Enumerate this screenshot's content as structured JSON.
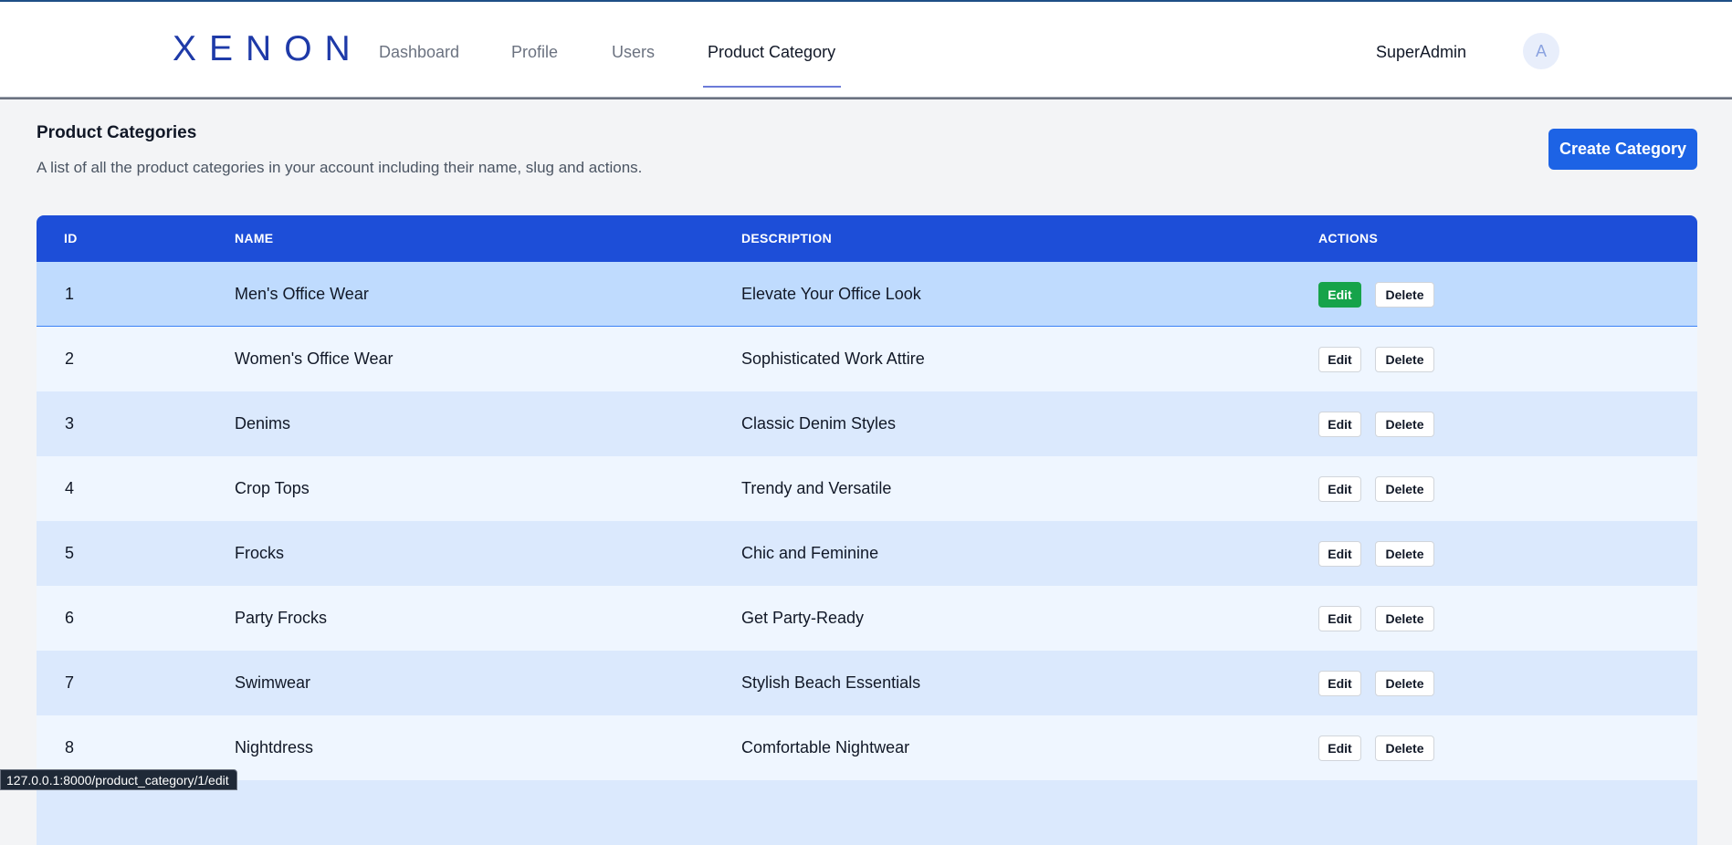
{
  "header": {
    "logo": "XENON",
    "nav": [
      {
        "label": "Dashboard"
      },
      {
        "label": "Profile"
      },
      {
        "label": "Users"
      },
      {
        "label": "Product Category"
      }
    ],
    "active_nav": "Product Category",
    "user_name": "SuperAdmin",
    "avatar_initial": "A"
  },
  "page": {
    "title": "Product Categories",
    "subtitle": "A list of all the product categories in your account including their name, slug and actions.",
    "create_label": "Create Category"
  },
  "table": {
    "columns": [
      "ID",
      "NAME",
      "DESCRIPTION",
      "ACTIONS"
    ],
    "edit_label": "Edit",
    "delete_label": "Delete",
    "rows": [
      {
        "id": "1",
        "name": "Men's Office Wear",
        "description": "Elevate Your Office Look"
      },
      {
        "id": "2",
        "name": "Women's Office Wear",
        "description": "Sophisticated Work Attire"
      },
      {
        "id": "3",
        "name": "Denims",
        "description": "Classic Denim Styles"
      },
      {
        "id": "4",
        "name": "Crop Tops",
        "description": "Trendy and Versatile"
      },
      {
        "id": "5",
        "name": "Frocks",
        "description": "Chic and Feminine"
      },
      {
        "id": "6",
        "name": "Party Frocks",
        "description": "Get Party-Ready"
      },
      {
        "id": "7",
        "name": "Swimwear",
        "description": "Stylish Beach Essentials"
      },
      {
        "id": "8",
        "name": "Nightdress",
        "description": "Comfortable Nightwear"
      }
    ]
  },
  "status_bar": {
    "url": "127.0.0.1:8000/product_category/1/edit"
  },
  "colors": {
    "brand": "#1e3aa8",
    "primary": "#1d4ed8",
    "edit_active": "#16a34a"
  }
}
